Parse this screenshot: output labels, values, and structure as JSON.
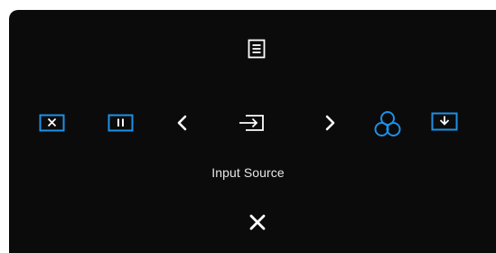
{
  "osd": {
    "center_label": "Input Source",
    "colors": {
      "background": "#0b0b0b",
      "accent": "#1e90e6",
      "foreground": "#ffffff"
    },
    "icons": {
      "top": "menu-icon",
      "row": [
        "x-box-icon",
        "pause-box-icon",
        "chevron-left-icon",
        "input-source-icon",
        "chevron-right-icon",
        "color-circles-icon",
        "download-box-icon"
      ],
      "bottom": "close-icon"
    }
  }
}
